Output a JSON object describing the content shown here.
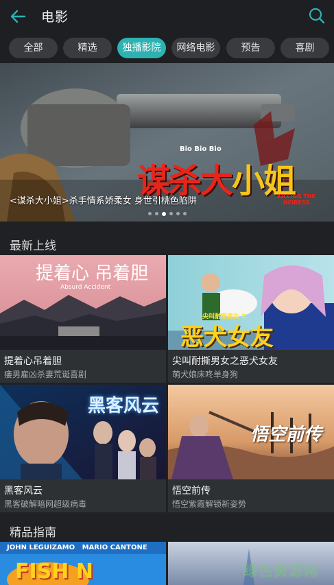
{
  "header": {
    "title": "电影",
    "back_icon": "arrow-left-icon",
    "search_icon": "search-icon",
    "accent_color": "#2db2b2"
  },
  "tabs": [
    {
      "label": "全部",
      "active": false
    },
    {
      "label": "精选",
      "active": false
    },
    {
      "label": "独播影院",
      "active": true
    },
    {
      "label": "网络电影",
      "active": false
    },
    {
      "label": "预告",
      "active": false
    },
    {
      "label": "喜剧",
      "active": false
    }
  ],
  "banner": {
    "caption": "<谋杀大小姐>杀手情系娇柔女 身世引桃色陷阱",
    "art_title_red": "谋杀大",
    "art_title_yellow": "小姐",
    "art_subtitle": "KILLING THE HEIRESS",
    "art_tag": "Bio Bio Bio",
    "slide_count": 6,
    "active_slide": 2
  },
  "sections": {
    "latest": "最新上线",
    "guide": "精品指南"
  },
  "cards": [
    {
      "name": "提着心吊着胆",
      "desc": "痿男雇凶杀妻荒诞喜剧",
      "art_title": "提着心 吊着胆",
      "art_sub": "Absurd Accident"
    },
    {
      "name": "尖叫耐撕男女之恶犬女友",
      "desc": "萌犬娘床咚单身狗",
      "art_title": "恶犬女友",
      "art_sub": "尖叫耐撕男女 2"
    },
    {
      "name": "黑客风云",
      "desc": "黑客破解暗网超级病毒",
      "art_title": "黑客风云",
      "art_sub": ""
    },
    {
      "name": "悟空前传",
      "desc": "悟空紫霞解锁新姿势",
      "art_title": "悟空前传",
      "art_sub": ""
    }
  ],
  "guide_cards": [
    {
      "art_names": "JOHN LEGUIZAMO   MARIO CANTONE",
      "art_title": "FISH N"
    },
    {
      "art_names": "",
      "art_title": ""
    }
  ],
  "watermark": "绿色资源网"
}
